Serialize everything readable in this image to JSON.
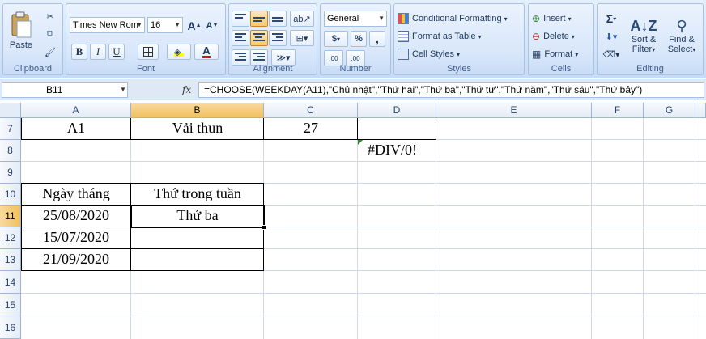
{
  "ribbon": {
    "clipboard": {
      "paste": "Paste",
      "label": "Clipboard"
    },
    "font": {
      "name": "Times New Rom",
      "size": "16",
      "label": "Font",
      "bold": "B",
      "italic": "I",
      "underline": "U",
      "grow": "A",
      "shrink": "A",
      "color_a": "A"
    },
    "alignment": {
      "label": "Alignment"
    },
    "number": {
      "format": "General",
      "currency": "$",
      "percent": "%",
      "comma": ",",
      "inc_decimal": ".00",
      "dec_decimal": ".00",
      "label": "Number"
    },
    "styles": {
      "conditional": "Conditional Formatting",
      "table": "Format as Table",
      "cell": "Cell Styles",
      "label": "Styles"
    },
    "cells": {
      "insert": "Insert",
      "delete": "Delete",
      "format": "Format",
      "label": "Cells"
    },
    "editing": {
      "sum": "Σ",
      "sort1": "Sort &",
      "sort2": "Filter",
      "find1": "Find &",
      "find2": "Select",
      "label": "Editing"
    }
  },
  "formula_bar": {
    "name_box": "B11",
    "fx": "fx",
    "formula": "=CHOOSE(WEEKDAY(A11),\"Chủ nhật\",\"Thứ hai\",\"Thứ ba\",\"Thứ tư\",\"Thứ năm\",\"Thứ sáu\",\"Thứ bảy\")"
  },
  "columns": [
    "A",
    "B",
    "C",
    "D",
    "E",
    "F",
    "G"
  ],
  "rows": [
    "7",
    "8",
    "9",
    "10",
    "11",
    "12",
    "13",
    "14",
    "15",
    "16"
  ],
  "cells": {
    "a7": "A1",
    "b7": "Vải thun",
    "c7": "27",
    "d8": "#DIV/0!",
    "a10": "Ngày tháng",
    "b10": "Thứ trong tuần",
    "a11": "25/08/2020",
    "b11": "Thứ ba",
    "a12": "15/07/2020",
    "a13": "21/09/2020"
  },
  "colors": {
    "accent": "#f1c15f",
    "ribbon": "#d6e6fa",
    "grid": "#d0d7e5"
  }
}
